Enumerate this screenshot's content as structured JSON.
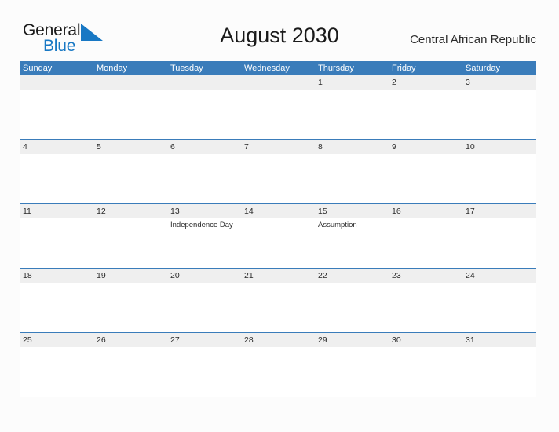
{
  "brand": {
    "word_one": "General",
    "word_two": "Blue",
    "flag_icon": "blue-flag-triangle-icon",
    "accent_color": "#1878c4"
  },
  "header": {
    "title": "August 2030",
    "country": "Central African Republic"
  },
  "theme": {
    "header_blue": "#3a7cba",
    "band_gray": "#efefef",
    "separator_blue": "#3a7cba",
    "page_background": "#fcfcfc",
    "text_color": "#2b2b2b"
  },
  "calendar": {
    "month": "August",
    "year": "2030",
    "weekday_headers": [
      "Sunday",
      "Monday",
      "Tuesday",
      "Wednesday",
      "Thursday",
      "Friday",
      "Saturday"
    ],
    "weeks": [
      [
        {
          "day": "",
          "events": []
        },
        {
          "day": "",
          "events": []
        },
        {
          "day": "",
          "events": []
        },
        {
          "day": "",
          "events": []
        },
        {
          "day": "1",
          "events": []
        },
        {
          "day": "2",
          "events": []
        },
        {
          "day": "3",
          "events": []
        }
      ],
      [
        {
          "day": "4",
          "events": []
        },
        {
          "day": "5",
          "events": []
        },
        {
          "day": "6",
          "events": []
        },
        {
          "day": "7",
          "events": []
        },
        {
          "day": "8",
          "events": []
        },
        {
          "day": "9",
          "events": []
        },
        {
          "day": "10",
          "events": []
        }
      ],
      [
        {
          "day": "11",
          "events": []
        },
        {
          "day": "12",
          "events": []
        },
        {
          "day": "13",
          "events": [
            "Independence Day"
          ]
        },
        {
          "day": "14",
          "events": []
        },
        {
          "day": "15",
          "events": [
            "Assumption"
          ]
        },
        {
          "day": "16",
          "events": []
        },
        {
          "day": "17",
          "events": []
        }
      ],
      [
        {
          "day": "18",
          "events": []
        },
        {
          "day": "19",
          "events": []
        },
        {
          "day": "20",
          "events": []
        },
        {
          "day": "21",
          "events": []
        },
        {
          "day": "22",
          "events": []
        },
        {
          "day": "23",
          "events": []
        },
        {
          "day": "24",
          "events": []
        }
      ],
      [
        {
          "day": "25",
          "events": []
        },
        {
          "day": "26",
          "events": []
        },
        {
          "day": "27",
          "events": []
        },
        {
          "day": "28",
          "events": []
        },
        {
          "day": "29",
          "events": []
        },
        {
          "day": "30",
          "events": []
        },
        {
          "day": "31",
          "events": []
        }
      ]
    ]
  }
}
